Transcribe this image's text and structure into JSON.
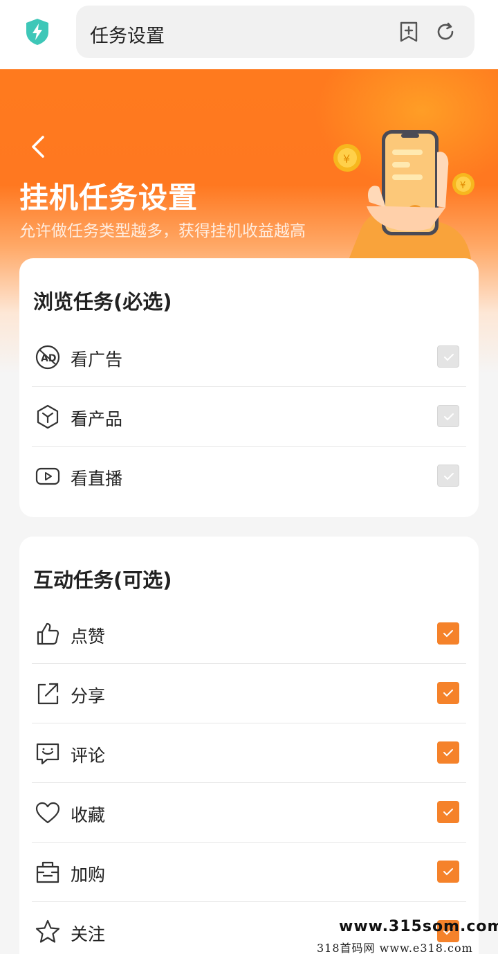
{
  "browser": {
    "url_title": "任务设置",
    "shield_color": "#3ec7b8"
  },
  "hero": {
    "title": "挂机任务设置",
    "subtitle": "允许做任务类型越多，获得挂机收益越高",
    "accent": "#ff7a1e"
  },
  "browse_section": {
    "title": "浏览任务(必选)",
    "items": [
      {
        "label": "看广告",
        "icon": "ad-icon",
        "checked": true,
        "disabled": true
      },
      {
        "label": "看产品",
        "icon": "cube-icon",
        "checked": true,
        "disabled": true
      },
      {
        "label": "看直播",
        "icon": "play-icon",
        "checked": true,
        "disabled": true
      }
    ]
  },
  "interact_section": {
    "title": "互动任务(可选)",
    "items": [
      {
        "label": "点赞",
        "icon": "thumbs-up-icon",
        "checked": true
      },
      {
        "label": "分享",
        "icon": "share-icon",
        "checked": true
      },
      {
        "label": "评论",
        "icon": "comment-icon",
        "checked": true
      },
      {
        "label": "收藏",
        "icon": "heart-icon",
        "checked": true
      },
      {
        "label": "加购",
        "icon": "cart-bag-icon",
        "checked": true
      },
      {
        "label": "关注",
        "icon": "star-icon",
        "checked": true
      }
    ]
  },
  "checkbox_color": "#f5822a",
  "watermark": {
    "line1": "www.315som.com",
    "line2": "318首码网  www.e318.com"
  }
}
